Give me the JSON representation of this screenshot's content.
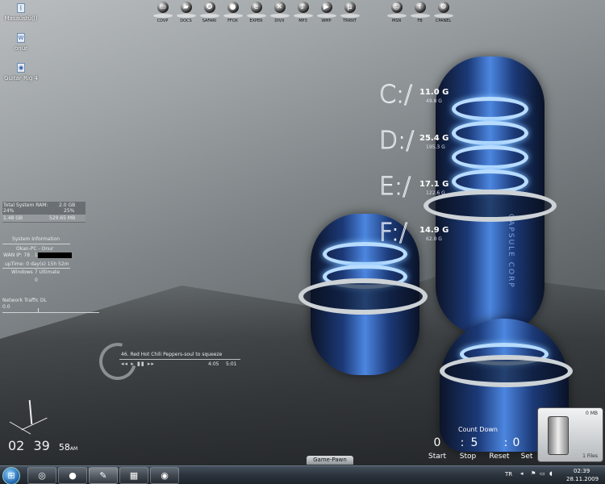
{
  "dock": {
    "items": [
      {
        "label": "CDVP",
        "icon": "monitor-icon",
        "glyph": "▭"
      },
      {
        "label": "DOCS",
        "icon": "folder-icon",
        "glyph": "▰"
      },
      {
        "label": "SAFARI",
        "icon": "compass-icon",
        "glyph": "✪"
      },
      {
        "label": "FFOX",
        "icon": "firefox-icon",
        "glyph": "●"
      },
      {
        "label": "EXPER",
        "icon": "ie-icon",
        "glyph": "e"
      },
      {
        "label": "DIVX",
        "icon": "divx-icon",
        "glyph": "✕"
      },
      {
        "label": "MP3",
        "icon": "music-icon",
        "glyph": "♪"
      },
      {
        "label": "WMP",
        "icon": "play-icon",
        "glyph": "▶"
      },
      {
        "label": "TRRNT",
        "icon": "torrent-icon",
        "glyph": "µ"
      }
    ],
    "items2": [
      {
        "label": "MSN",
        "icon": "msn-icon",
        "glyph": "☺"
      },
      {
        "label": "FB",
        "icon": "facebook-icon",
        "glyph": "f"
      },
      {
        "label": "CPANEL",
        "icon": "gear-icon",
        "glyph": "⚙"
      }
    ]
  },
  "desktop_icons": [
    {
      "label": "Masaüstü(l)",
      "icon": "bluetooth-icon",
      "glyph": "ᛒ"
    },
    {
      "label": "onur",
      "icon": "document-icon",
      "glyph": "W"
    },
    {
      "label": "Guitar Rig 4",
      "icon": "guitar-rig-icon",
      "glyph": "◉"
    }
  ],
  "ram": {
    "title": "Total System RAM:",
    "total": "2.0 GB",
    "pct_left": "24%",
    "pct_right": "25%",
    "used": "1.48 GB",
    "free": "529.65 MB"
  },
  "sysinfo": {
    "title": "System Information",
    "host": "Okan-PC - Onur",
    "wan": "WAN IP: 78 . 187 .",
    "uptime": "upTime: 0 day(s) 15h 52m",
    "os": "Windows 7 Ultimate",
    "dot": "0"
  },
  "network": {
    "title": "Network Traffic DL",
    "value": "0.0"
  },
  "media": {
    "track": "46. Red Hot Chili Peppers-soul to squeeze",
    "elapsed": "4:05",
    "total": "5:01",
    "controls": "◂◂ ▸ ▮▮ ▸▸"
  },
  "clock": {
    "h": "02",
    "m": "39",
    "s": "58",
    "ampm": "AM"
  },
  "drives": [
    {
      "letter": "C:/",
      "big": "11.0 G",
      "small": "49.8 G"
    },
    {
      "letter": "D:/",
      "big": "25.4 G",
      "small": "195.3 G"
    },
    {
      "letter": "E:/",
      "big": "17.1 G",
      "small": "122.6 G"
    },
    {
      "letter": "F:/",
      "big": "14.9 G",
      "small": "62.0 G"
    }
  ],
  "countdown": {
    "title": "Count Down",
    "v1": "0",
    "sep1": ":",
    "v2": "5",
    "sep2": ":",
    "v3": "0",
    "start": "Start",
    "stop": "Stop",
    "reset": "Reset",
    "set": "Set"
  },
  "game_tab": "Game-Pawn",
  "thumb": {
    "top": "0 MB",
    "bottom": "1 Files"
  },
  "taskbar": {
    "start_glyph": "⊞",
    "buttons": [
      {
        "glyph": "◎",
        "icon": "ie-icon"
      },
      {
        "glyph": "●",
        "icon": "firefox-icon"
      },
      {
        "glyph": "✎",
        "icon": "app-icon"
      },
      {
        "glyph": "▦",
        "icon": "messenger-icon"
      },
      {
        "glyph": "◉",
        "icon": "disc-icon"
      }
    ],
    "lang": "TR",
    "time": "02:39",
    "date": "28.11.2009"
  },
  "brand_text": "CAPSULE CORP"
}
